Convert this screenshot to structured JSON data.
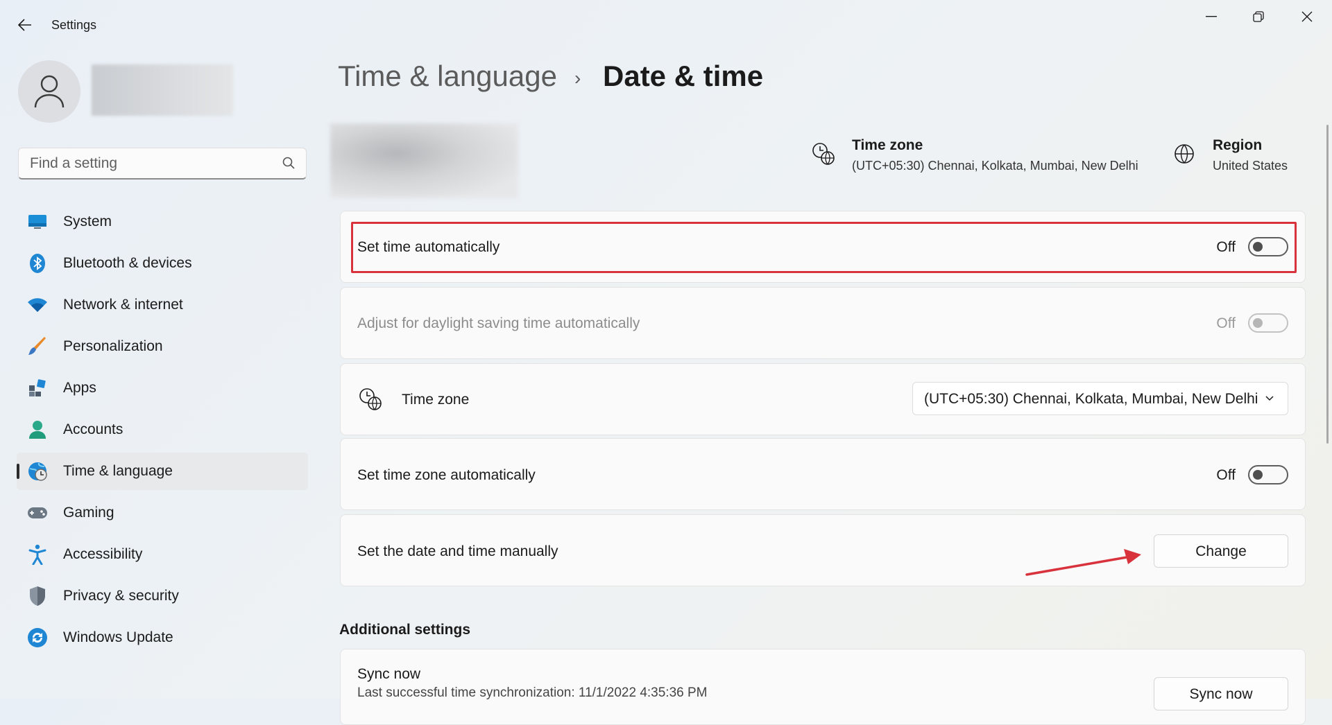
{
  "window": {
    "title": "Settings",
    "back_icon": "back-arrow-icon",
    "controls": [
      "minimize-icon",
      "restore-icon",
      "close-icon"
    ]
  },
  "search": {
    "placeholder": "Find a setting"
  },
  "nav": {
    "items": [
      {
        "label": "System",
        "icon": "system-icon"
      },
      {
        "label": "Bluetooth & devices",
        "icon": "bluetooth-icon"
      },
      {
        "label": "Network & internet",
        "icon": "wifi-icon"
      },
      {
        "label": "Personalization",
        "icon": "brush-icon"
      },
      {
        "label": "Apps",
        "icon": "apps-icon"
      },
      {
        "label": "Accounts",
        "icon": "accounts-icon"
      },
      {
        "label": "Time & language",
        "icon": "time-language-icon",
        "active": true
      },
      {
        "label": "Gaming",
        "icon": "gaming-icon"
      },
      {
        "label": "Accessibility",
        "icon": "accessibility-icon"
      },
      {
        "label": "Privacy & security",
        "icon": "shield-icon"
      },
      {
        "label": "Windows Update",
        "icon": "windows-update-icon"
      }
    ]
  },
  "header": {
    "parent": "Time & language",
    "separator": "›",
    "current": "Date & time"
  },
  "summary": {
    "timezone_title": "Time zone",
    "timezone_value": "(UTC+05:30) Chennai, Kolkata, Mumbai, New Delhi",
    "region_title": "Region",
    "region_value": "United States"
  },
  "settings": {
    "set_time_auto": {
      "label": "Set time automatically",
      "state": "Off"
    },
    "daylight": {
      "label": "Adjust for daylight saving time automatically",
      "state": "Off"
    },
    "timezone": {
      "label": "Time zone",
      "value": "(UTC+05:30) Chennai, Kolkata, Mumbai, New Delhi"
    },
    "set_tz_auto": {
      "label": "Set time zone automatically",
      "state": "Off"
    },
    "manual": {
      "label": "Set the date and time manually",
      "button": "Change"
    }
  },
  "additional": {
    "heading": "Additional settings",
    "sync_title": "Sync now",
    "sync_status": "Last successful time synchronization: 11/1/2022 4:35:36 PM",
    "sync_button": "Sync now"
  },
  "colors": {
    "highlight": "#d8323c",
    "arrow": "#d8323c",
    "active_indicator": "#2b2b2b"
  }
}
